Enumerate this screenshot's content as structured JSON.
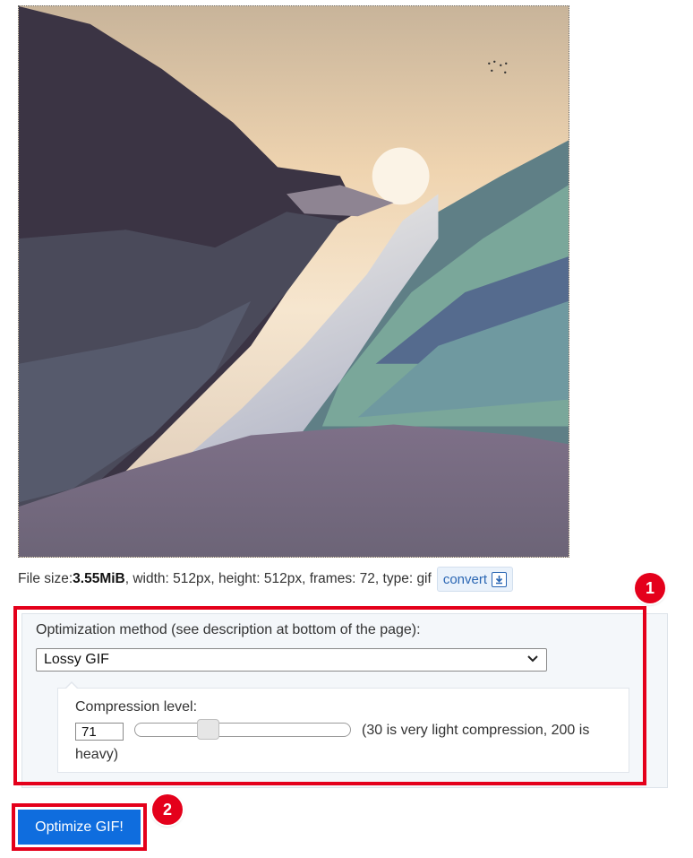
{
  "file_info": {
    "prefix": "File size: ",
    "size": "3.55MiB",
    "details": ", width: 512px, height: 512px, frames: 72, type: gif",
    "convert_label": "convert"
  },
  "options": {
    "method_label": "Optimization method (see description at bottom of the page):",
    "method_selected": "Lossy GIF",
    "compression_label": "Compression level:",
    "compression_value": "71",
    "compression_hint_line1": "(30 is very light compression, 200 is",
    "compression_hint_line2": "heavy)"
  },
  "action": {
    "optimize_label": "Optimize GIF!"
  },
  "annotations": {
    "badge1": "1",
    "badge2": "2"
  },
  "colors": {
    "highlight": "#e4001b",
    "primary_button": "#0f6dde"
  }
}
